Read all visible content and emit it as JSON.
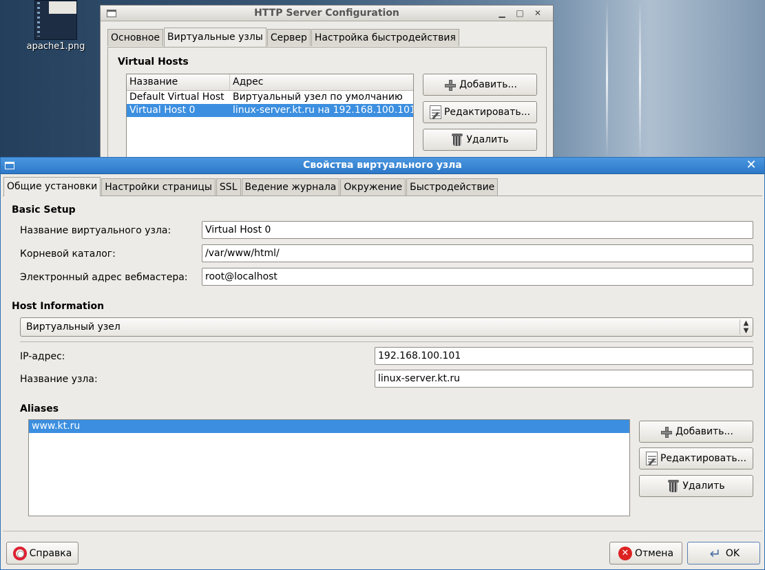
{
  "desktop": {
    "icon_label": "apache1.png"
  },
  "main_window": {
    "title": "HTTP Server Configuration",
    "tabs": [
      "Основное",
      "Виртуальные узлы",
      "Сервер",
      "Настройка быстродействия"
    ],
    "section_title": "Virtual Hosts",
    "list_headers": [
      "Название",
      "Адрес"
    ],
    "rows": [
      {
        "name": "Default Virtual Host",
        "address": "Виртуальный узел по умолчанию",
        "selected": false
      },
      {
        "name": "Virtual Host 0",
        "address": "linux-server.kt.ru на 192.168.100.101",
        "selected": true
      }
    ],
    "add_label": "Добавить...",
    "edit_label": "Редактировать...",
    "delete_label": "Удалить"
  },
  "dialog": {
    "title": "Свойства виртуального узла",
    "tabs": [
      "Общие установки",
      "Настройки страницы",
      "SSL",
      "Ведение журнала",
      "Окружение",
      "Быстродействие"
    ],
    "basic_setup": {
      "heading": "Basic Setup",
      "host_name_label": "Название виртуального узла:",
      "host_name_value": "Virtual Host 0",
      "doc_root_label": "Корневой каталог:",
      "doc_root_value": "/var/www/html/",
      "email_label": "Электронный адрес вебмастера:",
      "email_value": "root@localhost"
    },
    "host_info": {
      "heading": "Host Information",
      "type_selected": "Виртуальный узел",
      "ip_label": "IP-адрес:",
      "ip_value": "192.168.100.101",
      "name_label": "Название узла:",
      "name_value": "linux-server.kt.ru"
    },
    "aliases": {
      "heading": "Aliases",
      "items": [
        "www.kt.ru"
      ],
      "add_label": "Добавить...",
      "edit_label": "Редактировать...",
      "delete_label": "Удалить"
    },
    "help_label": "Справка",
    "cancel_label": "Отмена",
    "ok_label": "OK"
  },
  "colors": {
    "selection": "#3c8fe0",
    "dialog_titlebar": "#2d78c8",
    "window_bg": "#edebe7"
  }
}
